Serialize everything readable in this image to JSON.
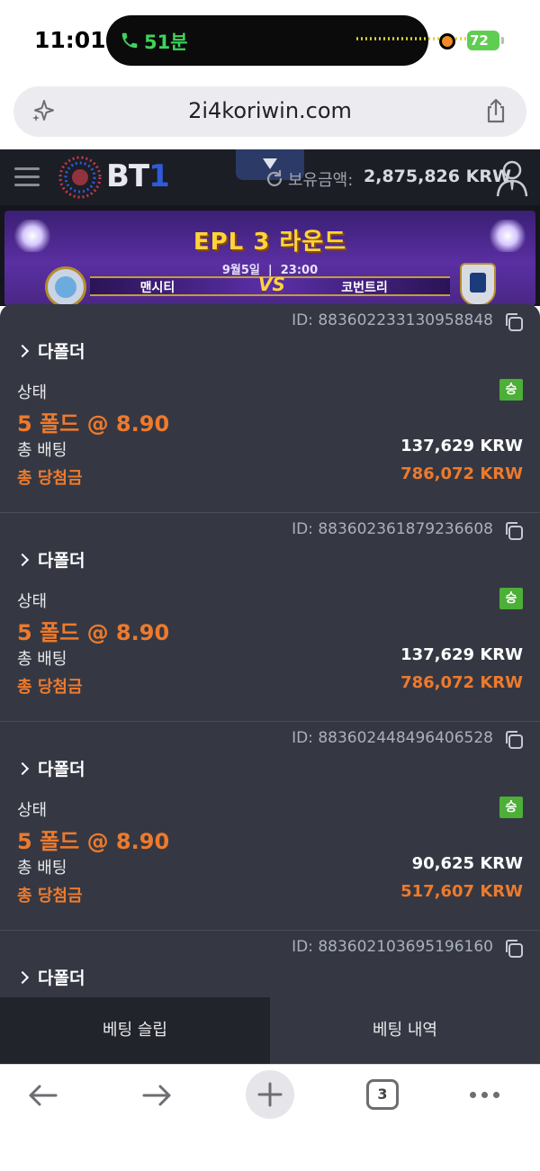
{
  "status_bar": {
    "time": "11:01",
    "call_duration": "51분",
    "battery": "72"
  },
  "browser": {
    "url": "2i4koriwin.com",
    "tabs_count": "3"
  },
  "site_header": {
    "logo": "BT1",
    "balance_label": "보유금액:",
    "balance_value": "2,875,826 KRW"
  },
  "banner": {
    "title": "EPL 3 라운드",
    "date": "9월5일",
    "time": "23:00",
    "home_team": "맨시티",
    "vs": "VS",
    "away_team": "코번트리"
  },
  "bets": [
    {
      "id": "ID: 883602233130958848",
      "type": "다폴더",
      "status_label": "상태",
      "result": "승",
      "odds": "5 폴드 @ 8.90",
      "stake_label": "총 배팅",
      "stake": "137,629 KRW",
      "payout_label": "총 당첨금",
      "payout": "786,072 KRW"
    },
    {
      "id": "ID: 883602361879236608",
      "type": "다폴더",
      "status_label": "상태",
      "result": "승",
      "odds": "5 폴드 @ 8.90",
      "stake_label": "총 배팅",
      "stake": "137,629 KRW",
      "payout_label": "총 당첨금",
      "payout": "786,072 KRW"
    },
    {
      "id": "ID: 883602448496406528",
      "type": "다폴더",
      "status_label": "상태",
      "result": "승",
      "odds": "5 폴드 @ 8.90",
      "stake_label": "총 배팅",
      "stake": "90,625 KRW",
      "payout_label": "총 당첨금",
      "payout": "517,607 KRW"
    },
    {
      "id": "ID: 883602103695196160",
      "type": "다폴더"
    }
  ],
  "bottom_tabs": {
    "betslip": "베팅 슬립",
    "history": "베팅 내역"
  },
  "colors": {
    "accent_orange": "#ee7a2d",
    "win_green": "#4caf37",
    "sheet_bg": "#353842"
  },
  "icons": [
    "phone-icon",
    "sparkle-icon",
    "share-icon",
    "menu-icon",
    "refresh-icon",
    "user-icon",
    "copy-icon",
    "back-arrow-icon",
    "forward-arrow-icon",
    "plus-icon",
    "more-icon"
  ]
}
